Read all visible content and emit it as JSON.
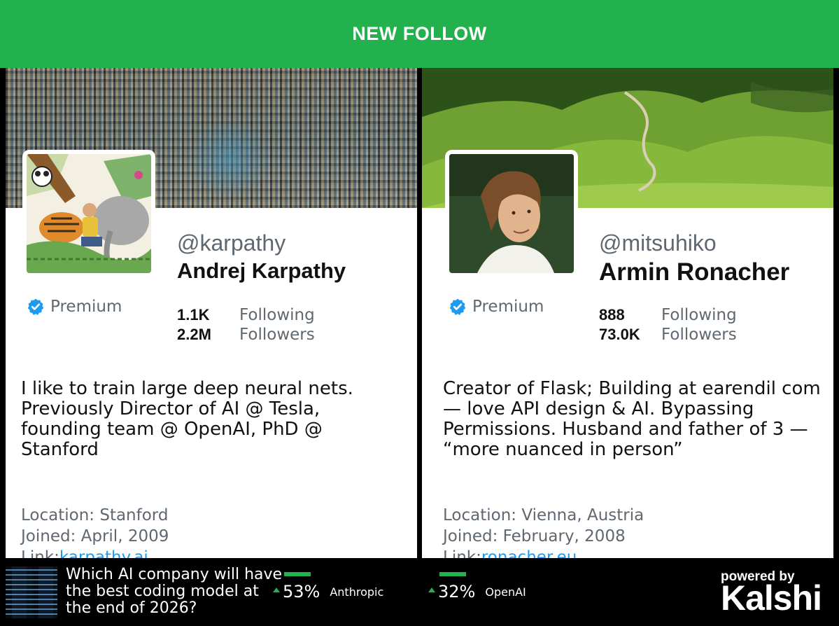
{
  "header": {
    "title": "NEW FOLLOW"
  },
  "colors": {
    "accent": "#22b14c",
    "verified": "#1d9bf0",
    "link": "#1d9bf0"
  },
  "profiles": [
    {
      "handle": "@karpathy",
      "name": "Andrej Karpathy",
      "premium": "Premium",
      "following_count": "1.1K",
      "following_label": "Following",
      "followers_count": "2.2M",
      "followers_label": "Followers",
      "bio": "I like to train large deep neural nets. Previously Director of AI @ Tesla, founding team @ OpenAI, PhD @ Stanford",
      "location": "Location: Stanford",
      "joined": "Joined: April, 2009",
      "link_label": "Link:",
      "link_url": "karpathy.ai"
    },
    {
      "handle": "@mitsuhiko",
      "name": "Armin Ronacher",
      "premium": "Premium",
      "following_count": "888",
      "following_label": "Following",
      "followers_count": "73.0K",
      "followers_label": "Followers",
      "bio": "Creator of Flask; Building at earendil com — love API design & AI. Bypassing Permissions. Husband and father of 3 — “more nuanced in person”",
      "location": "Location: Vienna, Austria",
      "joined": "Joined: February, 2008",
      "link_label": "Link:",
      "link_url": "ronacher.eu"
    }
  ],
  "market": {
    "question": "Which AI company will have the best coding model at the end of 2026?",
    "options": [
      {
        "percent": "53%",
        "label": "Anthropic"
      },
      {
        "percent": "32%",
        "label": "OpenAI"
      }
    ],
    "powered_by": "powered by",
    "brand": "Kalshi"
  }
}
